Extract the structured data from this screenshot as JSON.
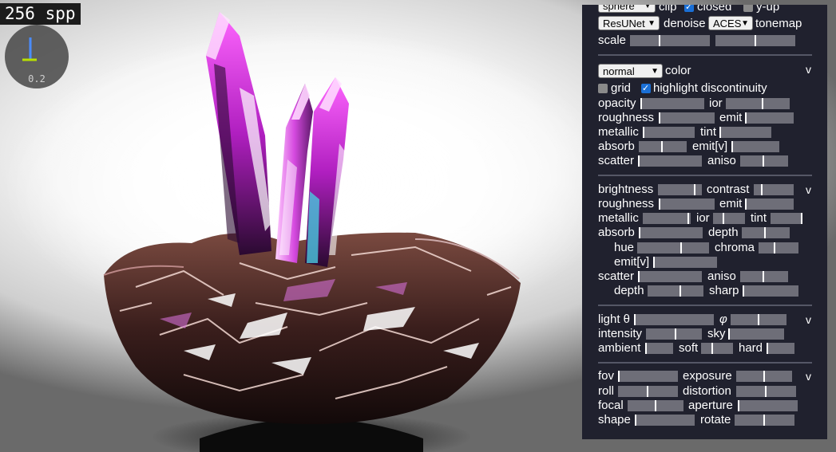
{
  "viewport": {
    "spp_label": "256 spp",
    "gizmo_value": "0.2"
  },
  "panel": {
    "top": {
      "shape_select": "sphere",
      "clip_label": "clip",
      "closed_label": "closed",
      "closed_checked": true,
      "yup_label": "y-up",
      "yup_checked": false,
      "denoise_select": "ResUNet",
      "denoise_label": "denoise",
      "tonemap_select": "ACES",
      "tonemap_label": "tonemap",
      "scale_label": "scale",
      "scale_a": 0.45,
      "scale_b": 0.5
    },
    "material": {
      "mode_select": "normal",
      "color_label": "color",
      "collapse": "v",
      "grid_label": "grid",
      "grid_checked": false,
      "highlight_label": "highlight discontinuity",
      "highlight_checked": true,
      "sliders": [
        {
          "l": "opacity",
          "v": 0.0
        },
        {
          "l": "ior",
          "v": 0.55
        },
        {
          "l": "roughness",
          "v": 0.0
        },
        {
          "l": "emit",
          "v": 0.0
        },
        {
          "l": "metallic",
          "v": 0.0
        },
        {
          "l": "tint",
          "v": 0.0
        },
        {
          "l": "absorb",
          "v": 0.5
        },
        {
          "l": "emit[v]",
          "v": 0.0
        },
        {
          "l": "scatter",
          "v": 0.0
        },
        {
          "l": "aniso",
          "v": 0.5
        }
      ]
    },
    "medium": {
      "collapse": "v",
      "sliders": [
        {
          "l": "brightness",
          "v": 0.9
        },
        {
          "l": "contrast",
          "v": 0.2
        },
        {
          "l": "roughness",
          "v": 0.0
        },
        {
          "l": "emit",
          "v": 0.0
        },
        {
          "l": "metallic",
          "v": 0.95
        },
        {
          "l": "ior",
          "v": 0.3
        },
        {
          "l": "tint",
          "v": 1.0
        },
        {
          "l": "absorb",
          "v": 0.0
        },
        {
          "l": "depth",
          "v": 0.5
        },
        {
          "l": "hue",
          "v": 0.6
        },
        {
          "l": "chroma",
          "v": 0.4
        },
        {
          "l": "emit[v]",
          "v": 0.0
        },
        {
          "l": "scatter",
          "v": 0.0
        },
        {
          "l": "aniso",
          "v": 0.5
        },
        {
          "l": "depth",
          "v": 0.6
        },
        {
          "l": "sharp",
          "v": 0.0
        }
      ]
    },
    "light": {
      "collapse": "v",
      "sliders": [
        {
          "l": "light θ",
          "v": 0.0
        },
        {
          "l": "φ",
          "v": 0.5
        },
        {
          "l": "intensity",
          "v": 0.5
        },
        {
          "l": "sky",
          "v": 0.0
        },
        {
          "l": "ambient",
          "v": 0.0
        },
        {
          "l": "soft",
          "v": 0.35
        },
        {
          "l": "hard",
          "v": 0.0
        }
      ]
    },
    "camera": {
      "collapse": "v",
      "sliders": [
        {
          "l": "fov",
          "v": 0.0
        },
        {
          "l": "exposure",
          "v": 0.5
        },
        {
          "l": "roll",
          "v": 0.5
        },
        {
          "l": "distortion",
          "v": 0.5
        },
        {
          "l": "focal",
          "v": 0.5
        },
        {
          "l": "aperture",
          "v": 0.0
        },
        {
          "l": "shape",
          "v": 0.0
        },
        {
          "l": "rotate",
          "v": 0.5
        }
      ]
    }
  }
}
